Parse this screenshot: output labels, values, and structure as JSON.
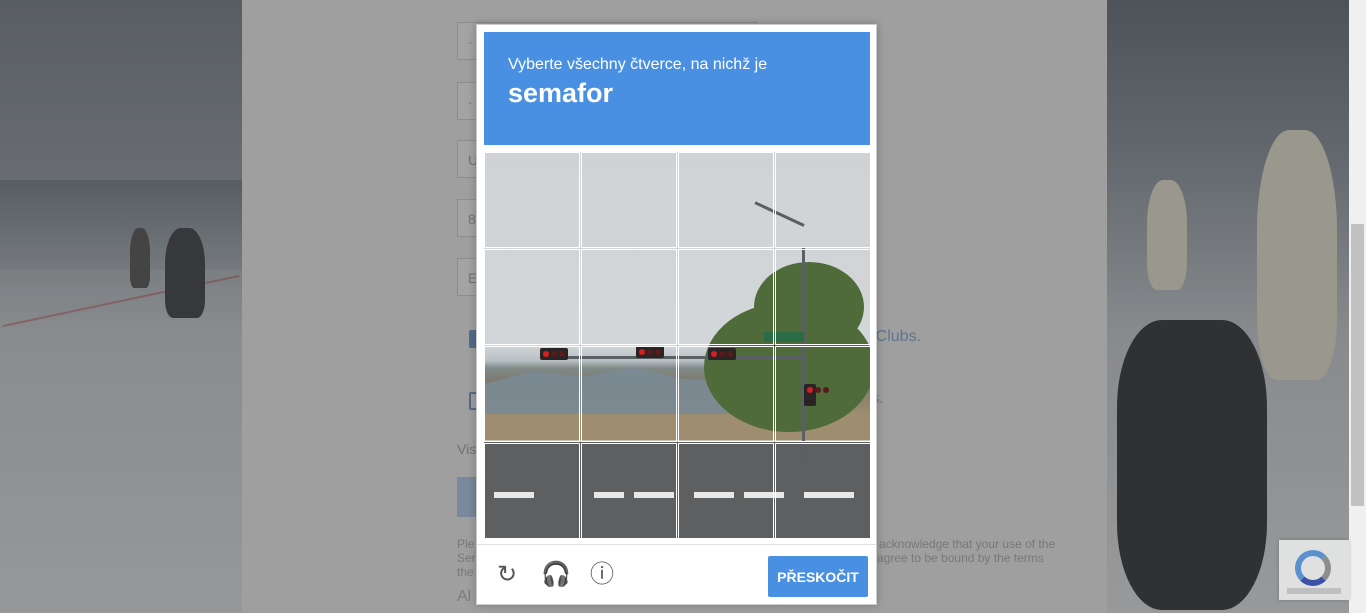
{
  "captcha": {
    "instruction": "Vyberte všechny čtverce, na nichž je",
    "target": "semafor",
    "skip_label": "PŘESKOČIT",
    "reload_icon": "↻",
    "audio_icon": "🎧",
    "info_icon": "ⓘ",
    "accent_color": "#4a90e2"
  },
  "form": {
    "field1": "·",
    "field2": "·",
    "field3": "U",
    "field4": "8",
    "field5": "E",
    "consent1_tail": "er Clubs.",
    "consent2_tail": "ers.",
    "vis_text": "Vis",
    "legal1_a": "Ple",
    "legal1_b": "acknowledge that your use of the",
    "legal2_a": "Ser",
    "legal2_b": "agree to be bound by the terms",
    "legal3_a": "the",
    "bottom_text": "Al"
  }
}
